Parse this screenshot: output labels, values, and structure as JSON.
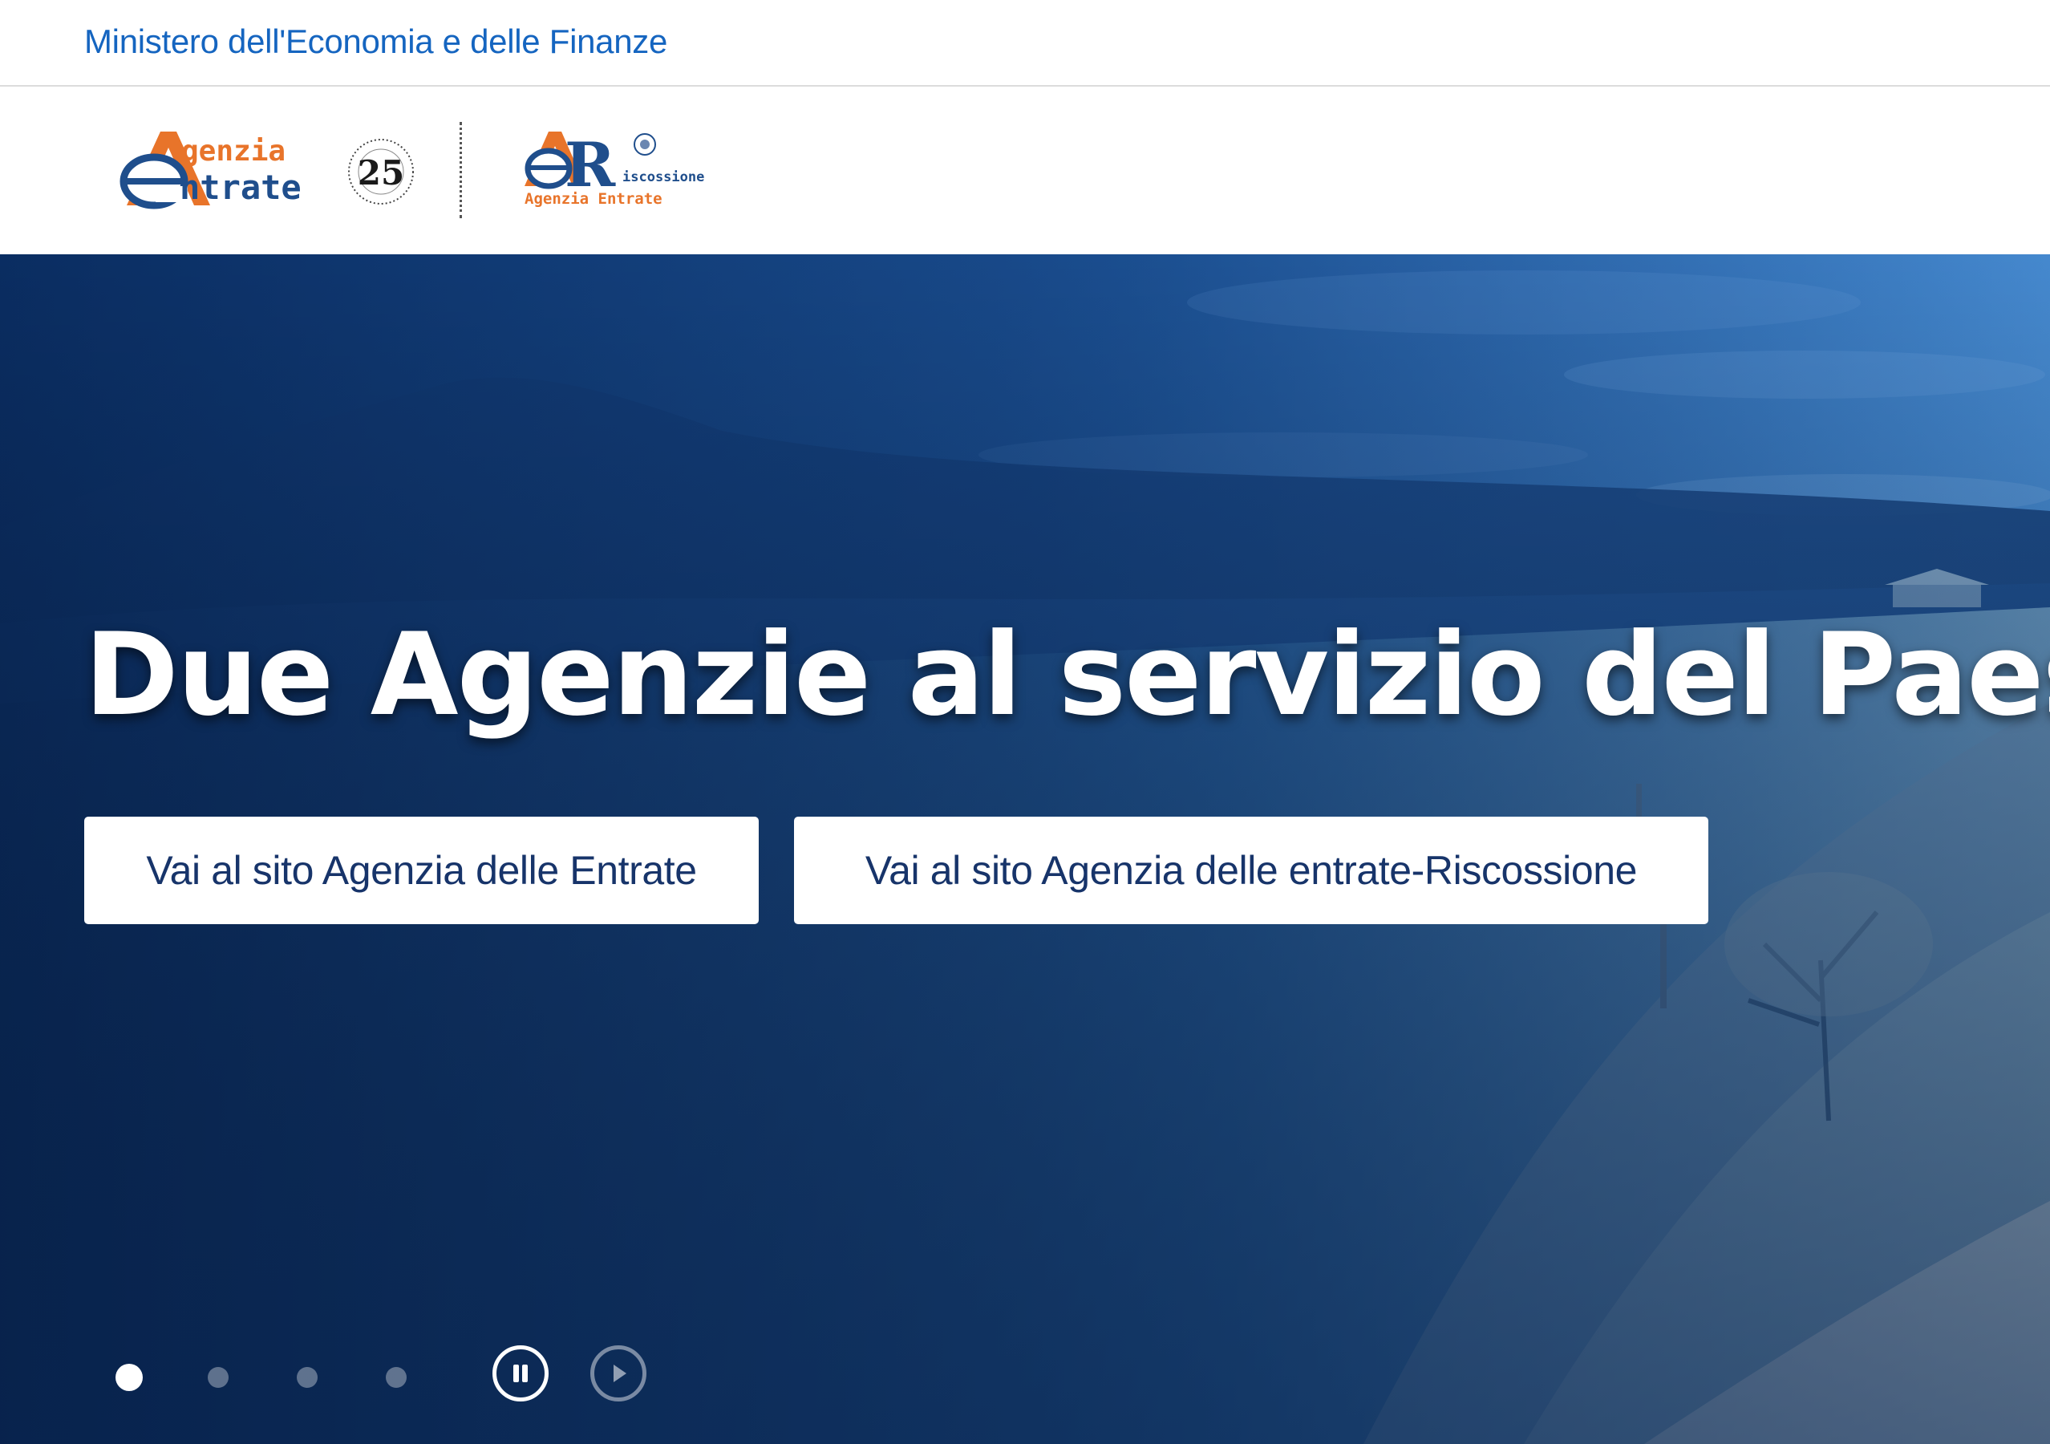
{
  "ministry": {
    "label": "Ministero dell'Economia e delle Finanze"
  },
  "logos": {
    "ae": {
      "line1": "genzia",
      "line2": "ntrate",
      "badge": "25",
      "icon": "agenzia-entrate-logo"
    },
    "aer": {
      "initials": "R",
      "sub1": "iscossione",
      "sub2": "Agenzia Entrate",
      "icon": "agenzia-entrate-riscossione-logo"
    }
  },
  "hero": {
    "title": "Due Agenzie al servizio del Paese",
    "buttons": [
      {
        "label": "Vai al sito Agenzia delle Entrate"
      },
      {
        "label": "Vai al sito Agenzia delle entrate-Riscossione"
      }
    ]
  },
  "carousel": {
    "slide_count": 4,
    "active_index": 0,
    "controls": [
      "pause-icon",
      "play-icon"
    ]
  },
  "colors": {
    "ministry_link": "#1565c0",
    "hero_blue": "#123d78",
    "logo_orange": "#e8742a",
    "logo_blue": "#1f4e8c",
    "button_text": "#17346a"
  }
}
